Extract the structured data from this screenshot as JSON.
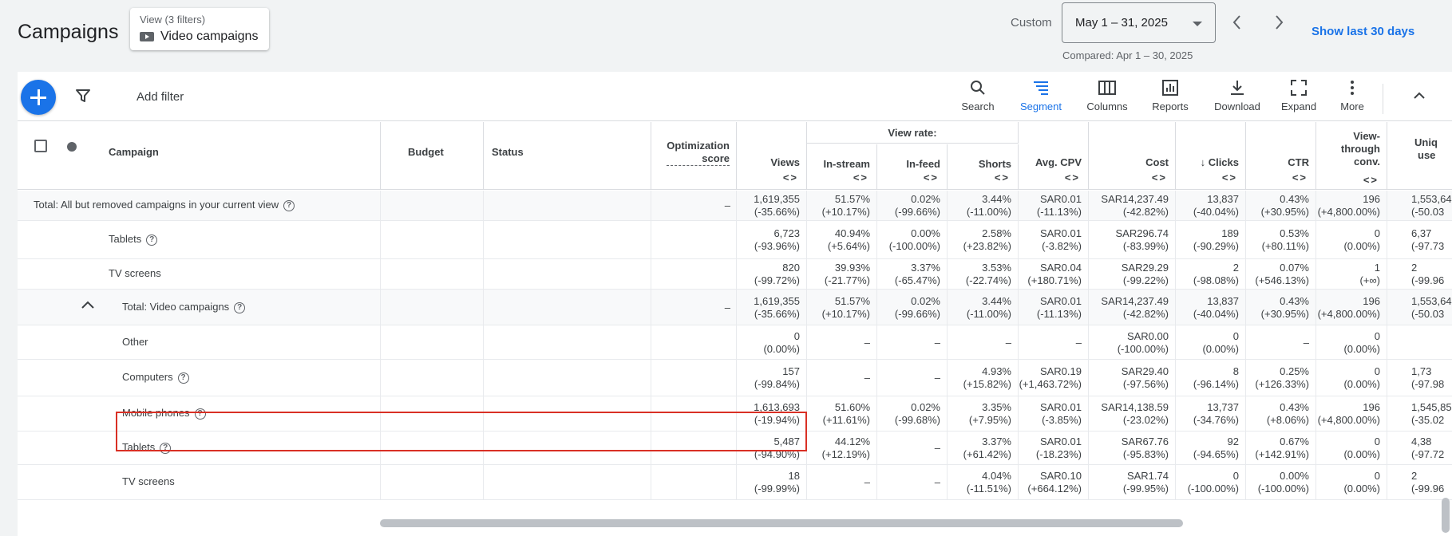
{
  "header": {
    "title": "Campaigns",
    "view_filters": "View (3 filters)",
    "view_name": "Video campaigns",
    "custom_label": "Custom",
    "date_range": "May 1 – 31, 2025",
    "compared": "Compared: Apr 1 – 30, 2025",
    "show_last": "Show last 30 days"
  },
  "toolbar": {
    "add_filter": "Add filter",
    "buttons": [
      {
        "label": "Search",
        "icon": "search-icon"
      },
      {
        "label": "Segment",
        "icon": "segment-icon",
        "active": true
      },
      {
        "label": "Columns",
        "icon": "columns-icon"
      },
      {
        "label": "Reports",
        "icon": "reports-icon"
      },
      {
        "label": "Download",
        "icon": "download-icon"
      },
      {
        "label": "Expand",
        "icon": "expand-icon"
      },
      {
        "label": "More",
        "icon": "more-vert-icon"
      }
    ]
  },
  "columns": {
    "campaign": "Campaign",
    "budget": "Budget",
    "status": "Status",
    "opt1": "Optimization",
    "opt2": "score",
    "views": "Views",
    "view_rate": "View rate:",
    "instream": "In-stream",
    "infeed": "In-feed",
    "shorts": "Shorts",
    "avgcpv": "Avg. CPV",
    "cost": "Cost",
    "clicks": "Clicks",
    "clicks_sort": "↓",
    "ctr": "CTR",
    "vtc1": "View-",
    "vtc2": "through",
    "vtc3": "conv.",
    "uniq1": "Uniq",
    "uniq2": "use",
    "sort_glyph": "<>"
  },
  "rows": [
    {
      "label": "Total: All but removed campaigns in your current view",
      "help": "?",
      "opt": "–",
      "views": [
        "1,619,355",
        "(-35.66%)"
      ],
      "instream": [
        "51.57%",
        "(+10.17%)"
      ],
      "infeed": [
        "0.02%",
        "(-99.66%)"
      ],
      "shorts": [
        "3.44%",
        "(-11.00%)"
      ],
      "avgcpv": [
        "SAR0.01",
        "(-11.13%)"
      ],
      "cost": [
        "SAR14,237.49",
        "(-42.82%)"
      ],
      "clicks": [
        "13,837",
        "(-40.04%)"
      ],
      "ctr": [
        "0.43%",
        "(+30.95%)"
      ],
      "vtc": [
        "196",
        "(+4,800.00%)"
      ],
      "uniq": [
        "1,553,64",
        "(-50.03"
      ]
    },
    {
      "label": "Tablets",
      "help": "?",
      "views": [
        "6,723",
        "(-93.96%)"
      ],
      "instream": [
        "40.94%",
        "(+5.64%)"
      ],
      "infeed": [
        "0.00%",
        "(-100.00%)"
      ],
      "shorts": [
        "2.58%",
        "(+23.82%)"
      ],
      "avgcpv": [
        "SAR0.01",
        "(-3.82%)"
      ],
      "cost": [
        "SAR296.74",
        "(-83.99%)"
      ],
      "clicks": [
        "189",
        "(-90.29%)"
      ],
      "ctr": [
        "0.53%",
        "(+80.11%)"
      ],
      "vtc": [
        "0",
        "(0.00%)"
      ],
      "uniq": [
        "6,37",
        "(-97.73"
      ]
    },
    {
      "label": "TV screens",
      "views": [
        "820",
        "(-99.72%)"
      ],
      "instream": [
        "39.93%",
        "(-21.77%)"
      ],
      "infeed": [
        "3.37%",
        "(-65.47%)"
      ],
      "shorts": [
        "3.53%",
        "(-22.74%)"
      ],
      "avgcpv": [
        "SAR0.04",
        "(+180.71%)"
      ],
      "cost": [
        "SAR29.29",
        "(-99.22%)"
      ],
      "clicks": [
        "2",
        "(-98.08%)"
      ],
      "ctr": [
        "0.07%",
        "(+546.13%)"
      ],
      "vtc": [
        "1",
        "(+∞)"
      ],
      "uniq": [
        "2",
        "(-99.96"
      ]
    },
    {
      "label": "Total: Video campaigns",
      "help": "?",
      "opt": "–",
      "views": [
        "1,619,355",
        "(-35.66%)"
      ],
      "instream": [
        "51.57%",
        "(+10.17%)"
      ],
      "infeed": [
        "0.02%",
        "(-99.66%)"
      ],
      "shorts": [
        "3.44%",
        "(-11.00%)"
      ],
      "avgcpv": [
        "SAR0.01",
        "(-11.13%)"
      ],
      "cost": [
        "SAR14,237.49",
        "(-42.82%)"
      ],
      "clicks": [
        "13,837",
        "(-40.04%)"
      ],
      "ctr": [
        "0.43%",
        "(+30.95%)"
      ],
      "vtc": [
        "196",
        "(+4,800.00%)"
      ],
      "uniq": [
        "1,553,64",
        "(-50.03"
      ]
    },
    {
      "label": "Other",
      "views": [
        "0",
        "(0.00%)"
      ],
      "instream": [
        "–"
      ],
      "infeed": [
        "–"
      ],
      "shorts": [
        "–"
      ],
      "avgcpv": [
        "–"
      ],
      "cost": [
        "SAR0.00",
        "(-100.00%)"
      ],
      "clicks": [
        "0",
        "(0.00%)"
      ],
      "ctr": [
        "–"
      ],
      "vtc": [
        "0",
        "(0.00%)"
      ],
      "uniq": [
        "",
        ""
      ]
    },
    {
      "label": "Computers",
      "help": "?",
      "views": [
        "157",
        "(-99.84%)"
      ],
      "instream": [
        "–"
      ],
      "infeed": [
        "–"
      ],
      "shorts": [
        "4.93%",
        "(+15.82%)"
      ],
      "avgcpv": [
        "SAR0.19",
        "(+1,463.72%)"
      ],
      "cost": [
        "SAR29.40",
        "(-97.56%)"
      ],
      "clicks": [
        "8",
        "(-96.14%)"
      ],
      "ctr": [
        "0.25%",
        "(+126.33%)"
      ],
      "vtc": [
        "0",
        "(0.00%)"
      ],
      "uniq": [
        "1,73",
        "(-97.98"
      ]
    },
    {
      "label": "Mobile phones",
      "help": "?",
      "views": [
        "1,613,693",
        "(-19.94%)"
      ],
      "instream": [
        "51.60%",
        "(+11.61%)"
      ],
      "infeed": [
        "0.02%",
        "(-99.68%)"
      ],
      "shorts": [
        "3.35%",
        "(+7.95%)"
      ],
      "avgcpv": [
        "SAR0.01",
        "(-3.85%)"
      ],
      "cost": [
        "SAR14,138.59",
        "(-23.02%)"
      ],
      "clicks": [
        "13,737",
        "(-34.76%)"
      ],
      "ctr": [
        "0.43%",
        "(+8.06%)"
      ],
      "vtc": [
        "196",
        "(+4,800.00%)"
      ],
      "uniq": [
        "1,545,85",
        "(-35.02"
      ]
    },
    {
      "label": "Tablets",
      "help": "?",
      "views": [
        "5,487",
        "(-94.90%)"
      ],
      "instream": [
        "44.12%",
        "(+12.19%)"
      ],
      "infeed": [
        "–"
      ],
      "shorts": [
        "3.37%",
        "(+61.42%)"
      ],
      "avgcpv": [
        "SAR0.01",
        "(-18.23%)"
      ],
      "cost": [
        "SAR67.76",
        "(-95.83%)"
      ],
      "clicks": [
        "92",
        "(-94.65%)"
      ],
      "ctr": [
        "0.67%",
        "(+142.91%)"
      ],
      "vtc": [
        "0",
        "(0.00%)"
      ],
      "uniq": [
        "4,38",
        "(-97.72"
      ]
    },
    {
      "label": "TV screens",
      "views": [
        "18",
        "(-99.99%)"
      ],
      "instream": [
        "–"
      ],
      "infeed": [
        "–"
      ],
      "shorts": [
        "4.04%",
        "(-11.51%)"
      ],
      "avgcpv": [
        "SAR0.10",
        "(+664.12%)"
      ],
      "cost": [
        "SAR1.74",
        "(-99.95%)"
      ],
      "clicks": [
        "0",
        "(-100.00%)"
      ],
      "ctr": [
        "0.00%",
        "(-100.00%)"
      ],
      "vtc": [
        "0",
        "(0.00%)"
      ],
      "uniq": [
        "2",
        "(-99.96"
      ]
    }
  ]
}
